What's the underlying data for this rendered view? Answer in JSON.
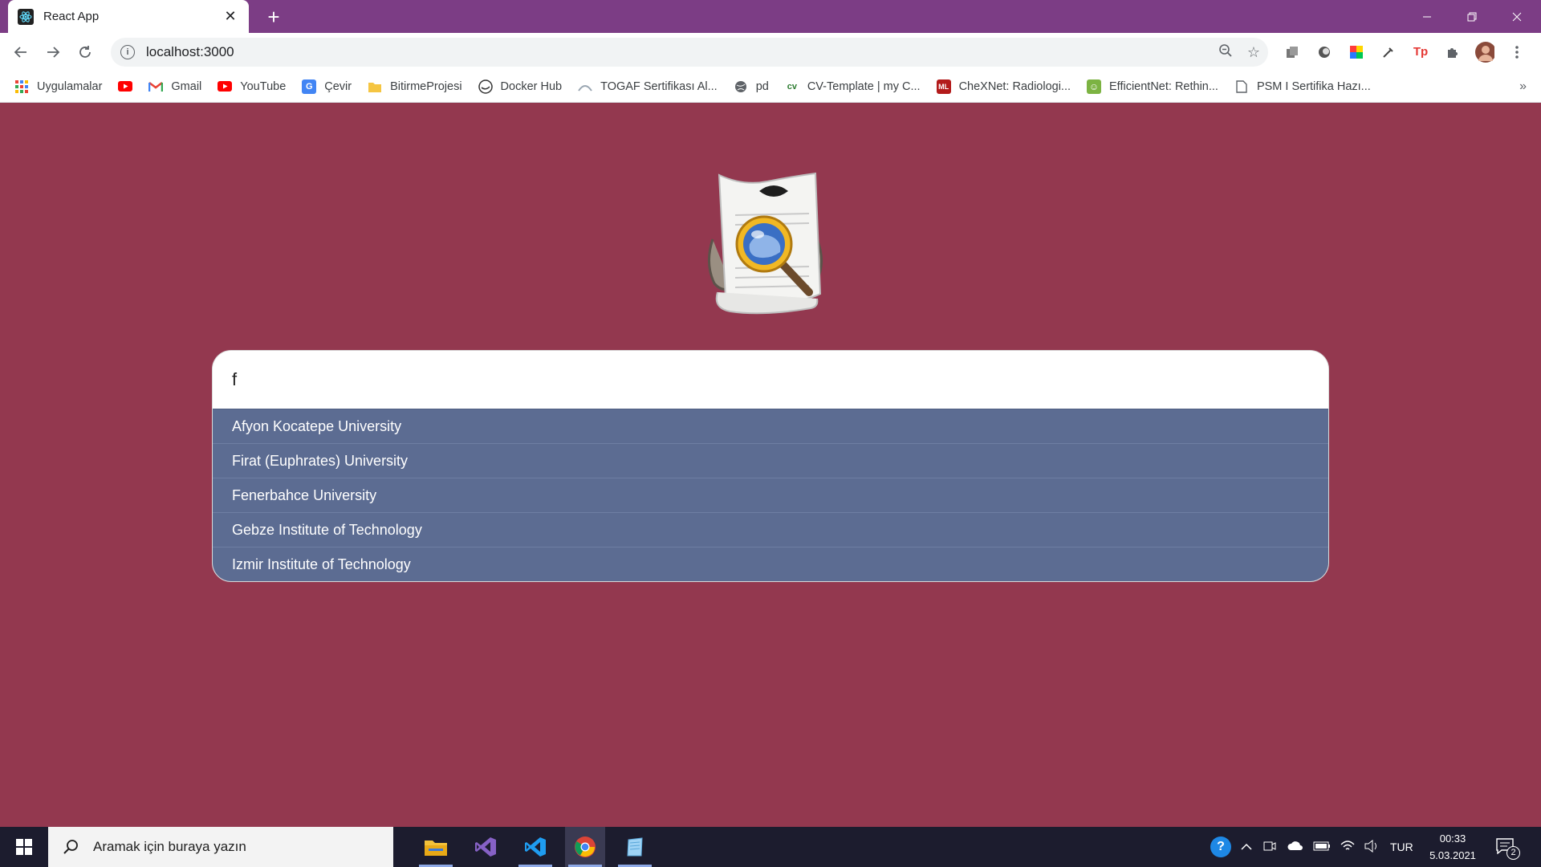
{
  "browser": {
    "tab_title": "React App",
    "url": "localhost:3000",
    "bookmarks": [
      {
        "label": "Uygulamalar",
        "icon": "apps-grid-icon"
      },
      {
        "label": "",
        "icon": "youtube-icon"
      },
      {
        "label": "Gmail",
        "icon": "gmail-icon"
      },
      {
        "label": "YouTube",
        "icon": "youtube-icon"
      },
      {
        "label": "Çevir",
        "icon": "translate-icon"
      },
      {
        "label": "BitirmeProjesi",
        "icon": "folder-icon"
      },
      {
        "label": "Docker Hub",
        "icon": "docker-icon"
      },
      {
        "label": "TOGAF Sertifikası Al...",
        "icon": "togaf-icon"
      },
      {
        "label": "pd",
        "icon": "globe-icon"
      },
      {
        "label": "CV-Template | my C...",
        "icon": "cv-icon"
      },
      {
        "label": "CheXNet: Radiologi...",
        "icon": "ml-icon"
      },
      {
        "label": "EfficientNet: Rethin...",
        "icon": "smiley-icon"
      },
      {
        "label": "PSM I Sertifika Hazı...",
        "icon": "page-icon"
      }
    ],
    "more_bookmarks": "»"
  },
  "app": {
    "search": {
      "value": "f",
      "placeholder": ""
    },
    "results": [
      "Afyon Kocatepe University",
      "Firat (Euphrates) University",
      "Fenerbahce University",
      "Gebze Institute of Technology",
      "Izmir Institute of Technology"
    ]
  },
  "taskbar": {
    "search_placeholder": "Aramak için buraya yazın",
    "language": "TUR",
    "time": "00:33",
    "date": "5.03.2021",
    "notification_count": "2"
  },
  "colors": {
    "page_background": "#93384f",
    "results_background": "#5c6c92",
    "title_bar": "#7c3d85"
  }
}
